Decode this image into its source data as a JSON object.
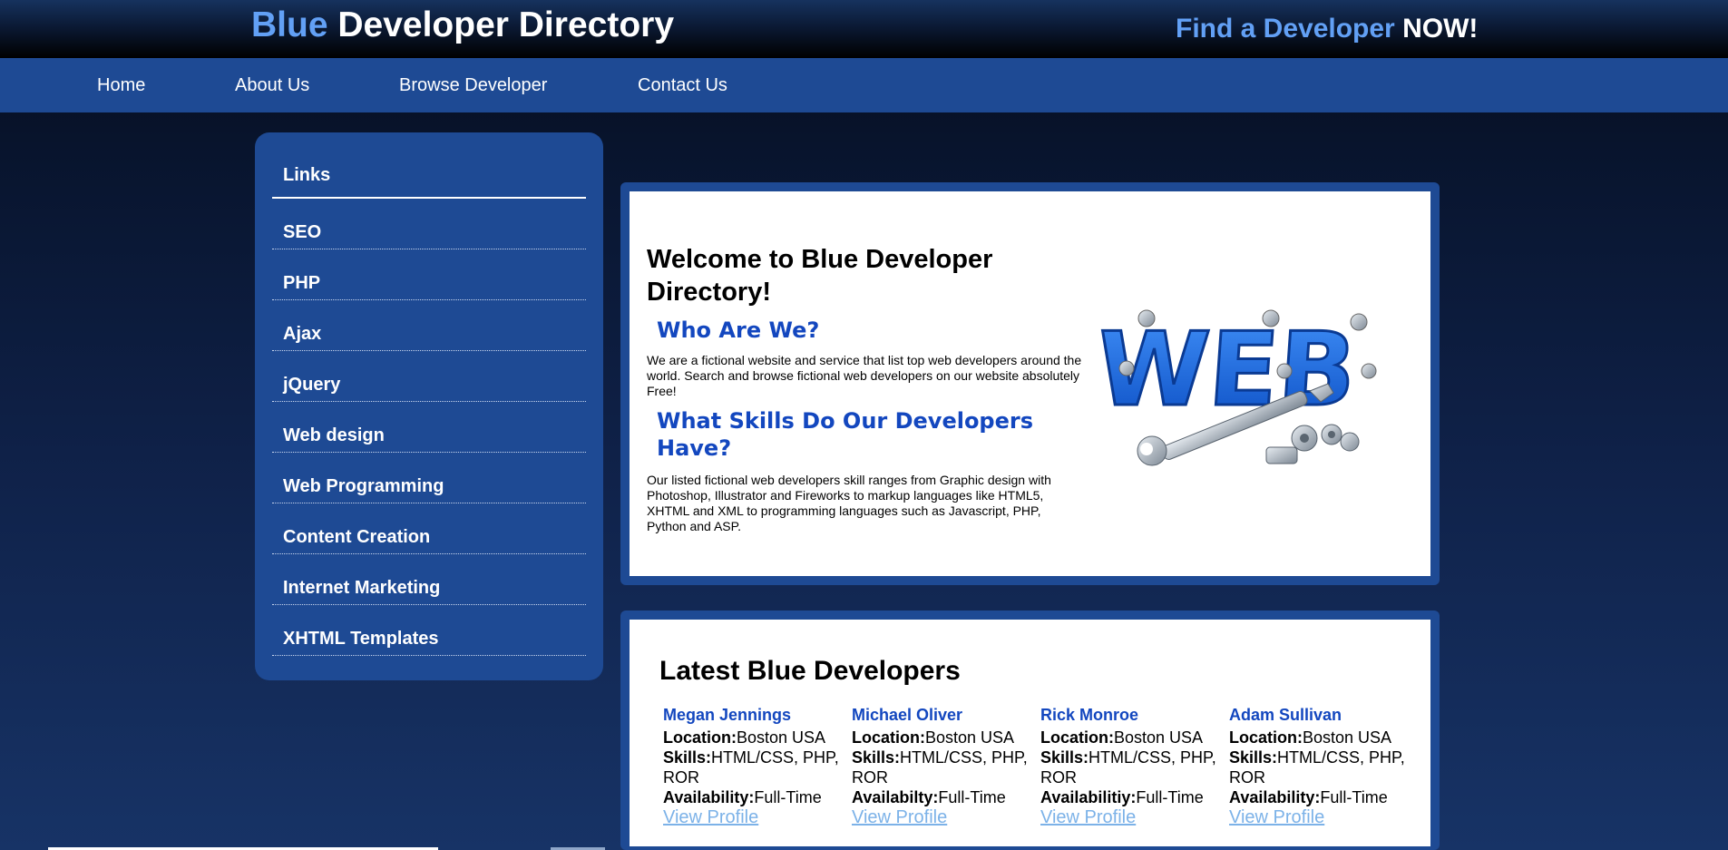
{
  "header": {
    "title_accent": "Blue",
    "title_rest": " Developer Directory",
    "tagline_accent": "Find a Developer",
    "tagline_rest": " NOW!"
  },
  "nav": {
    "items": [
      {
        "label": "Home"
      },
      {
        "label": "About Us"
      },
      {
        "label": "Browse Developer"
      },
      {
        "label": "Contact Us"
      }
    ]
  },
  "sidebar": {
    "heading": "Links",
    "items": [
      {
        "label": "SEO"
      },
      {
        "label": "PHP"
      },
      {
        "label": "Ajax"
      },
      {
        "label": "jQuery"
      },
      {
        "label": "Web design"
      },
      {
        "label": "Web Programming"
      },
      {
        "label": "Content Creation"
      },
      {
        "label": "Internet Marketing"
      },
      {
        "label": "XHTML Templates"
      }
    ]
  },
  "welcome": {
    "title": "Welcome to Blue Developer Directory!",
    "who_heading": "Who Are We?",
    "who_text": "We are a fictional website and service that list top web developers around the world. Search and browse fictional web developers on our website absolutely Free!",
    "skills_heading": "What Skills Do Our Developers Have?",
    "skills_text": "Our listed fictional web developers skill ranges from Graphic design with Photoshop, Illustrator and Fireworks to markup languages like HTML5, XHTML and XML to programming languages such as Javascript, PHP, Python and ASP.",
    "graphic_text": "WEB"
  },
  "latest": {
    "title": "Latest Blue Developers",
    "developers": [
      {
        "name": "Megan Jennings",
        "location_label": "Location:",
        "location": "Boston USA",
        "skills_label": "Skills:",
        "skills": "HTML/CSS, PHP, ROR",
        "availability_label": "Availability:",
        "availability": "Full-Time",
        "link": "View Profile"
      },
      {
        "name": "Michael Oliver",
        "location_label": "Location:",
        "location": "Boston USA",
        "skills_label": "Skills:",
        "skills": "HTML/CSS, PHP, ROR",
        "availability_label": "Availabilty:",
        "availability": "Full-Time",
        "link": "View Profile"
      },
      {
        "name": "Rick Monroe",
        "location_label": "Location:",
        "location": "Boston USA",
        "skills_label": "Skills:",
        "skills": "HTML/CSS, PHP, ROR",
        "availability_label": "Availabilitiy:",
        "availability": "Full-Time",
        "link": "View Profile"
      },
      {
        "name": "Adam Sullivan",
        "location_label": "Location:",
        "location": "Boston USA",
        "skills_label": "Skills:",
        "skills": "HTML/CSS, PHP, ROR",
        "availability_label": "Availability:",
        "availability": "Full-Time",
        "link": "View Profile"
      }
    ]
  },
  "colors": {
    "accent_blue": "#62a0f5",
    "nav_blue": "#1e4a94",
    "heading_blue": "#1347bf",
    "link_blue": "#7cb2e8"
  }
}
